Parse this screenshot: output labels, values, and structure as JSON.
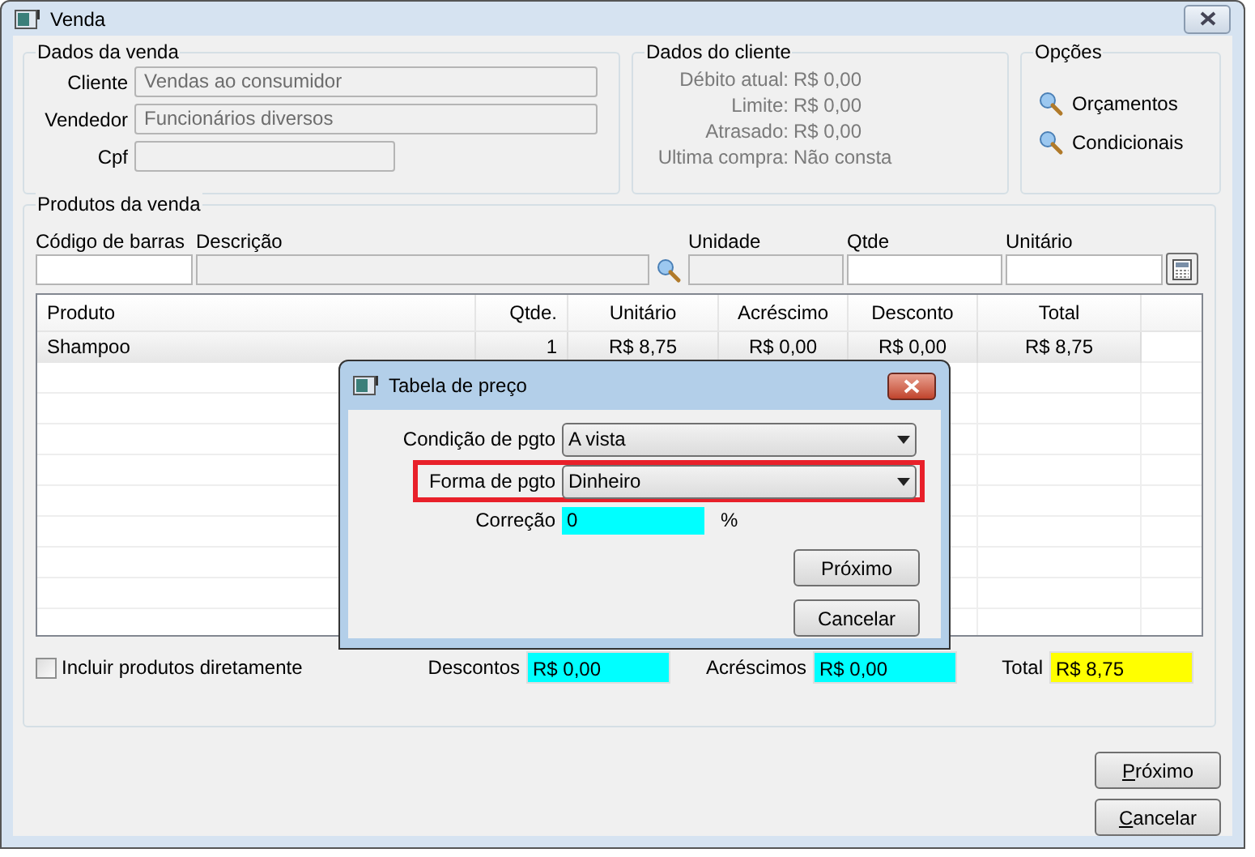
{
  "window": {
    "title": "Venda"
  },
  "dados_venda": {
    "title": "Dados da venda",
    "fields": [
      {
        "label": "Cliente",
        "value": "Vendas ao consumidor",
        "disabled": true
      },
      {
        "label": "Vendedor",
        "value": "Funcionários diversos",
        "disabled": true
      },
      {
        "label": "Cpf",
        "disabled": true
      }
    ]
  },
  "dados_cliente": {
    "title": "Dados do cliente",
    "rows": [
      {
        "label": "Débito atual:",
        "value": "R$ 0,00"
      },
      {
        "label": "Limite:",
        "value": "R$ 0,00"
      },
      {
        "label": "Atrasado:",
        "value": "R$ 0,00"
      },
      {
        "label": "Ultima compra:",
        "value": "Não consta"
      }
    ]
  },
  "opcoes": {
    "title": "Opções",
    "links": [
      "Orçamentos",
      "Condicionais"
    ]
  },
  "produtos": {
    "title": "Produtos da venda",
    "inputs": {
      "codigo": "Código de barras",
      "descricao": "Descrição",
      "unidade": "Unidade",
      "qtde": "Qtde",
      "unitario": "Unitário"
    },
    "table": {
      "columns": [
        "Produto",
        "Qtde.",
        "Unitário",
        "Acréscimo",
        "Desconto",
        "Total"
      ],
      "rows": [
        [
          "Shampoo",
          "1",
          "R$ 8,75",
          "R$ 0,00",
          "R$ 0,00",
          "R$ 8,75"
        ]
      ]
    },
    "incluir": {
      "label": "Incluir produtos diretamente",
      "checked": false
    },
    "totals": [
      {
        "label": "Descontos",
        "value": "R$ 0,00",
        "color": "#00ffff"
      },
      {
        "label": "Acréscimos",
        "value": "R$ 0,00",
        "color": "#00ffff"
      },
      {
        "label": "Total",
        "value": "R$ 8,75",
        "color": "#ffff00"
      }
    ]
  },
  "buttons": [
    "Próximo",
    "Cancelar"
  ],
  "dialog": {
    "title": "Tabela de preço",
    "condicao": {
      "label": "Condição de pgto",
      "value": "A vista"
    },
    "forma": {
      "label": "Forma de pgto",
      "value": "Dinheiro",
      "highlighted": true
    },
    "correcao": {
      "label": "Correção",
      "value": "0",
      "unit": "%"
    },
    "buttons": [
      "Próximo",
      "Cancelar"
    ]
  }
}
